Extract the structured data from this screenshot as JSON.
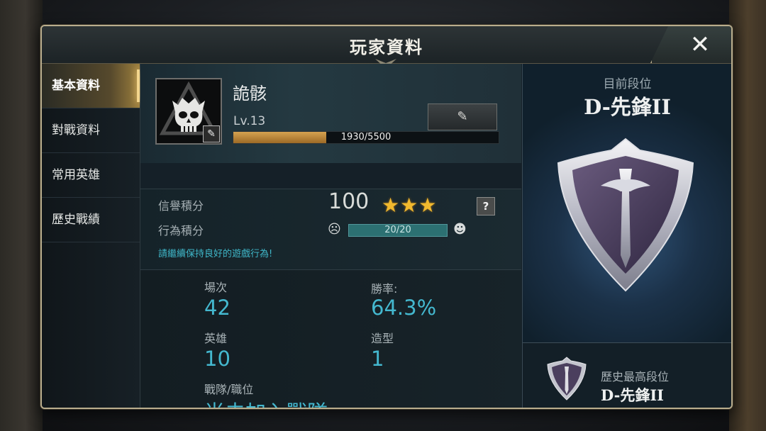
{
  "window": {
    "title": "玩家資料",
    "close_label": "✕"
  },
  "sidebar": {
    "items": [
      {
        "label": "基本資料",
        "active": true
      },
      {
        "label": "對戰資料",
        "active": false
      },
      {
        "label": "常用英雄",
        "active": false
      },
      {
        "label": "歷史戰績",
        "active": false
      }
    ]
  },
  "profile": {
    "name": "詭骸",
    "level": "Lv.13",
    "xp_text": "1930/5500",
    "xp_current": 1930,
    "xp_max": 5500,
    "avatar_icon": "skull-icon",
    "edit_icon": "pencil-icon"
  },
  "credit": {
    "credit_label": "信譽積分",
    "credit_score": "100",
    "stars": "★★★",
    "star_count": 3,
    "help_label": "?",
    "behavior_label": "行為積分",
    "behavior_text": "20/20",
    "sad_face": "☹",
    "happy_face": "☻",
    "tip": "請繼續保持良好的遊戲行為!"
  },
  "stats": {
    "matches_label": "場次",
    "matches_value": "42",
    "winrate_label": "勝率:",
    "winrate_value": "64.3%",
    "heroes_label": "英雄",
    "heroes_value": "10",
    "skins_label": "造型",
    "skins_value": "1",
    "team_label": "戰隊/職位",
    "team_value": "尚未加入戰隊"
  },
  "rank": {
    "current_caption": "目前段位",
    "current_name": "D-先鋒II",
    "history_caption": "歷史最高段位",
    "history_name": "D-先鋒II"
  },
  "colors": {
    "accent_gold": "#b9ad8d",
    "stat_cyan": "#44b8cf",
    "xp_gold": "#d5a250",
    "star_gold": "#f1b92e"
  }
}
